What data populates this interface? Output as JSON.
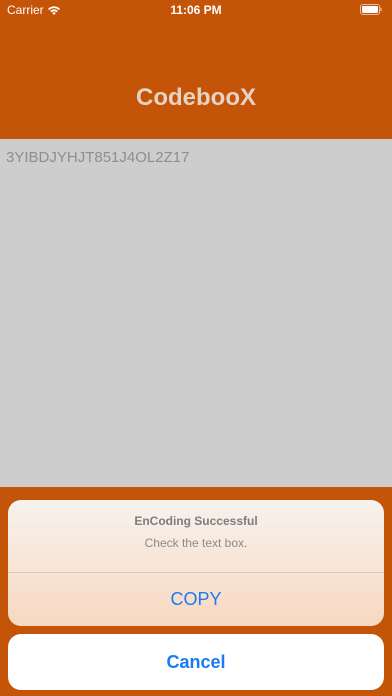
{
  "status_bar": {
    "carrier": "Carrier",
    "time": "11:06 PM"
  },
  "nav": {
    "title": "CodebooX"
  },
  "text_box": {
    "content": "3YIBDJYHJT851J4OL2Z17"
  },
  "alert": {
    "title": "EnCoding Successful",
    "message": "Check the text box.",
    "copy_label": "COPY",
    "cancel_label": "Cancel"
  },
  "colors": {
    "brand_orange": "#c45508",
    "action_blue": "#1a7cf3"
  },
  "icons": [
    "wifi-icon",
    "battery-icon"
  ]
}
